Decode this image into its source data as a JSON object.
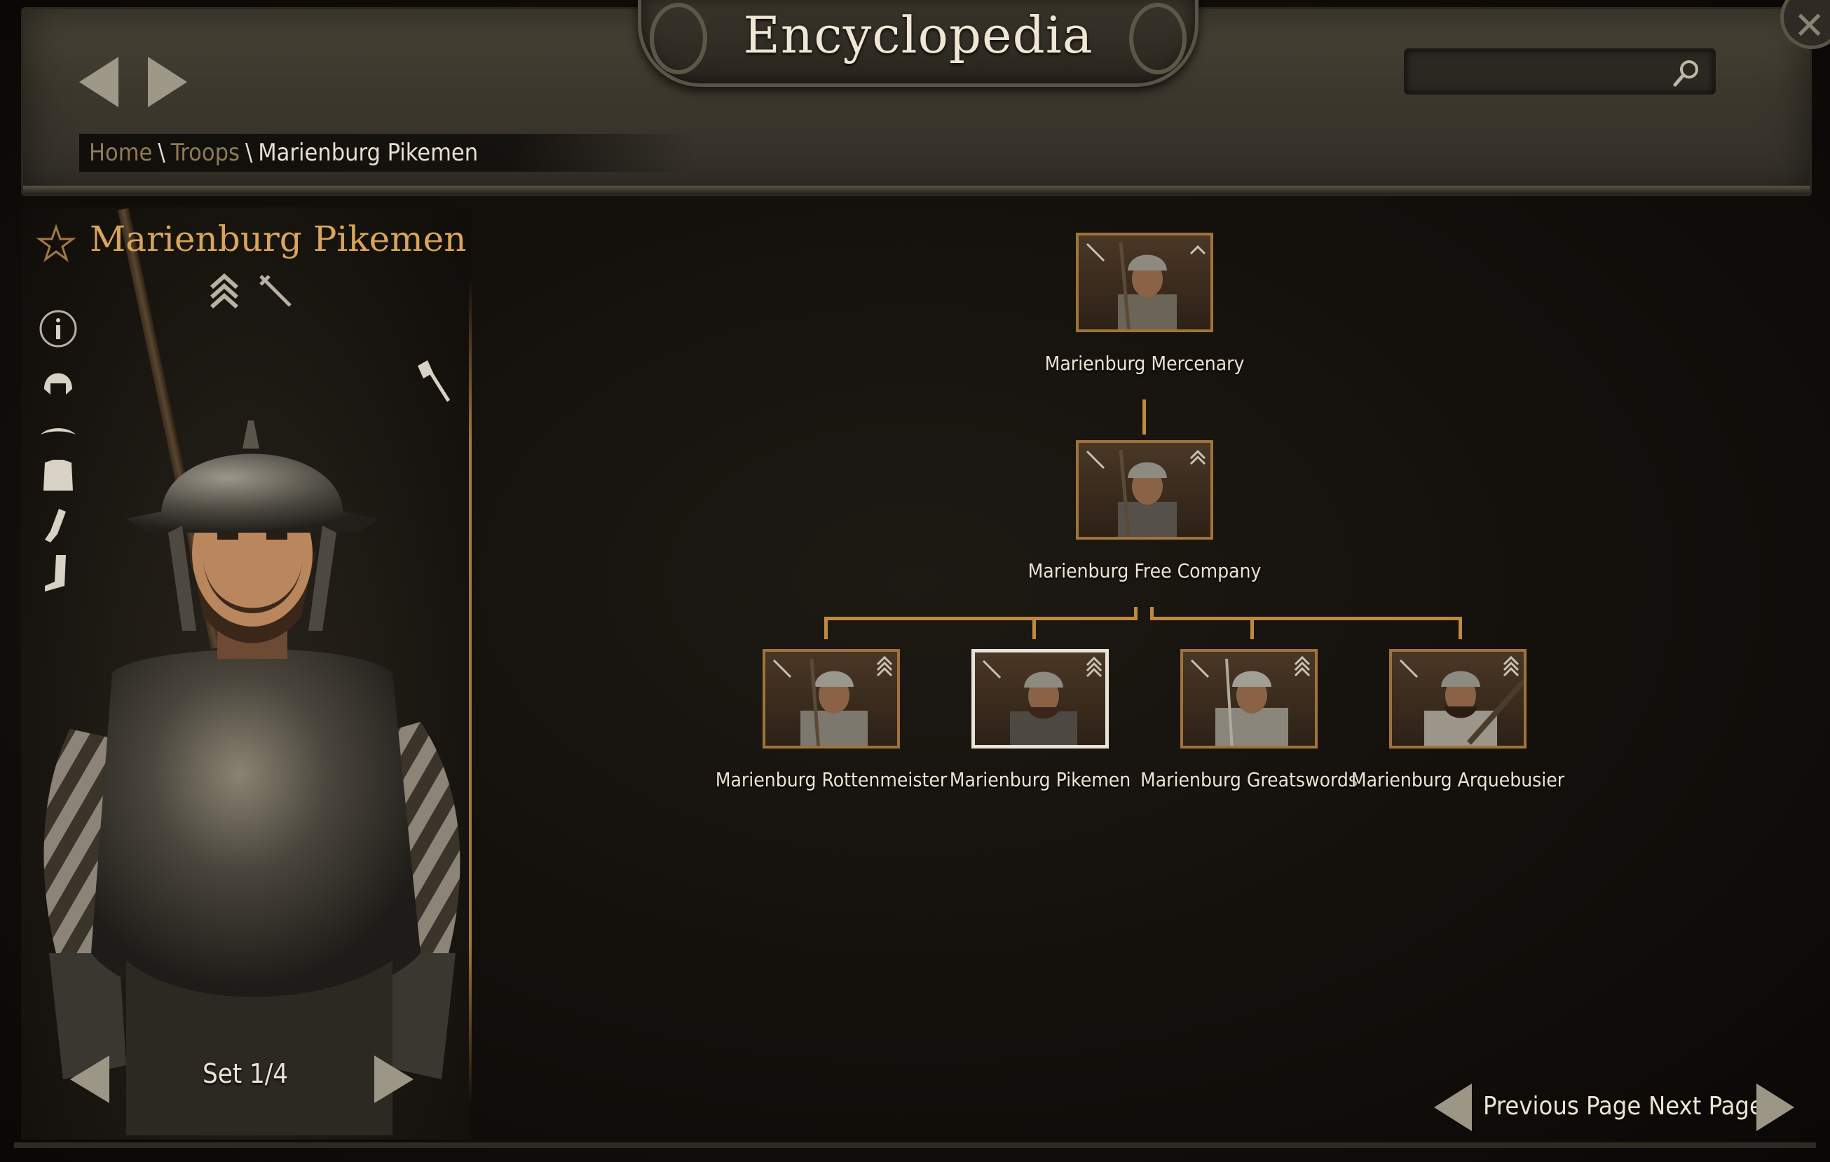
{
  "header": {
    "title": "Encyclopedia",
    "search": {
      "value": "",
      "placeholder": ""
    }
  },
  "breadcrumb": {
    "items": [
      {
        "label": "Home"
      },
      {
        "label": "Troops"
      },
      {
        "label": "Marienburg Pikemen"
      }
    ],
    "separator": "\\"
  },
  "troop": {
    "name": "Marienburg Pikemen",
    "tier_icon": "double-chevron-icon",
    "class_icon": "sword-icon",
    "equipment_set": "Set 1/4",
    "side_icons": [
      "info-icon",
      "helmet-icon",
      "cape-icon",
      "body-armor-icon",
      "gloves-icon",
      "boots-icon"
    ],
    "weapon_icon": "halberd-icon"
  },
  "tree": {
    "root": {
      "name": "Marienburg Mercenary"
    },
    "mid": {
      "name": "Marienburg Free Company"
    },
    "leaves": [
      {
        "name": "Marienburg Rottenmeister"
      },
      {
        "name": "Marienburg Pikemen",
        "selected": true
      },
      {
        "name": "Marienburg Greatswords"
      },
      {
        "name": "Marienburg Arquebusier"
      }
    ]
  },
  "pagination": {
    "prev": "Previous Page",
    "next": "Next Page"
  },
  "colors": {
    "accent": "#d9a45b",
    "tree_line": "#c08a3e",
    "text": "#ece4d3"
  }
}
